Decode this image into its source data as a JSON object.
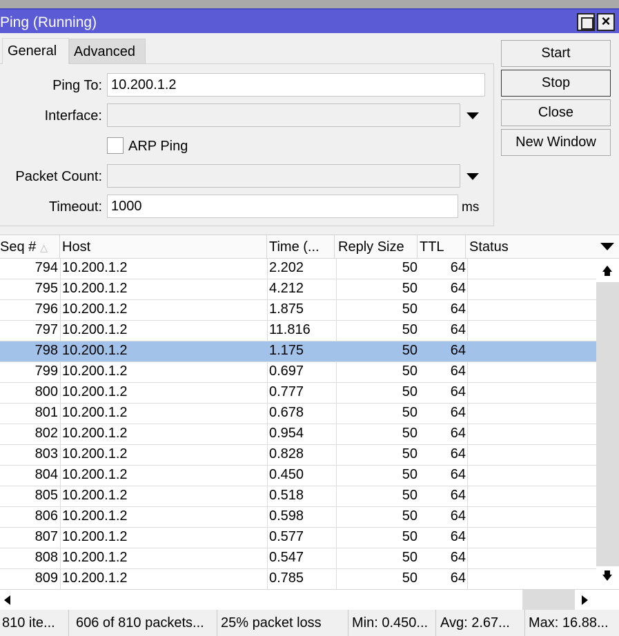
{
  "window": {
    "title": "Ping (Running)"
  },
  "tabs": [
    {
      "label": "General"
    },
    {
      "label": "Advanced"
    }
  ],
  "form": {
    "ping_to": {
      "label": "Ping To:",
      "value": "10.200.1.2"
    },
    "interface": {
      "label": "Interface:",
      "value": ""
    },
    "arp_ping": {
      "label": "ARP Ping",
      "checked": false
    },
    "packet_count": {
      "label": "Packet Count:",
      "value": ""
    },
    "timeout": {
      "label": "Timeout:",
      "value": "1000",
      "unit": "ms"
    }
  },
  "buttons": {
    "start": "Start",
    "stop": "Stop",
    "close": "Close",
    "new_window": "New Window"
  },
  "table": {
    "columns": [
      "Seq #",
      "Host",
      "Time (...",
      "Reply Size",
      "TTL",
      "Status"
    ],
    "selected_seq": "798",
    "rows": [
      {
        "seq": "794",
        "host": "10.200.1.2",
        "time": "2.202",
        "reply_size": "50",
        "ttl": "64",
        "status": ""
      },
      {
        "seq": "795",
        "host": "10.200.1.2",
        "time": "4.212",
        "reply_size": "50",
        "ttl": "64",
        "status": ""
      },
      {
        "seq": "796",
        "host": "10.200.1.2",
        "time": "1.875",
        "reply_size": "50",
        "ttl": "64",
        "status": ""
      },
      {
        "seq": "797",
        "host": "10.200.1.2",
        "time": "11.816",
        "reply_size": "50",
        "ttl": "64",
        "status": ""
      },
      {
        "seq": "798",
        "host": "10.200.1.2",
        "time": "1.175",
        "reply_size": "50",
        "ttl": "64",
        "status": ""
      },
      {
        "seq": "799",
        "host": "10.200.1.2",
        "time": "0.697",
        "reply_size": "50",
        "ttl": "64",
        "status": ""
      },
      {
        "seq": "800",
        "host": "10.200.1.2",
        "time": "0.777",
        "reply_size": "50",
        "ttl": "64",
        "status": ""
      },
      {
        "seq": "801",
        "host": "10.200.1.2",
        "time": "0.678",
        "reply_size": "50",
        "ttl": "64",
        "status": ""
      },
      {
        "seq": "802",
        "host": "10.200.1.2",
        "time": "0.954",
        "reply_size": "50",
        "ttl": "64",
        "status": ""
      },
      {
        "seq": "803",
        "host": "10.200.1.2",
        "time": "0.828",
        "reply_size": "50",
        "ttl": "64",
        "status": ""
      },
      {
        "seq": "804",
        "host": "10.200.1.2",
        "time": "0.450",
        "reply_size": "50",
        "ttl": "64",
        "status": ""
      },
      {
        "seq": "805",
        "host": "10.200.1.2",
        "time": "0.518",
        "reply_size": "50",
        "ttl": "64",
        "status": ""
      },
      {
        "seq": "806",
        "host": "10.200.1.2",
        "time": "0.598",
        "reply_size": "50",
        "ttl": "64",
        "status": ""
      },
      {
        "seq": "807",
        "host": "10.200.1.2",
        "time": "0.577",
        "reply_size": "50",
        "ttl": "64",
        "status": ""
      },
      {
        "seq": "808",
        "host": "10.200.1.2",
        "time": "0.547",
        "reply_size": "50",
        "ttl": "64",
        "status": ""
      },
      {
        "seq": "809",
        "host": "10.200.1.2",
        "time": "0.785",
        "reply_size": "50",
        "ttl": "64",
        "status": ""
      }
    ]
  },
  "status_bar": {
    "items": "810 ite...",
    "packets": "606 of 810 packets...",
    "loss": "25% packet loss",
    "min": "Min: 0.450...",
    "avg": "Avg: 2.67...",
    "max": "Max: 16.88..."
  },
  "icons": {
    "maximize": "maximize-icon",
    "close": "close-icon",
    "dropdown": "chevron-down-icon",
    "sort": "sort-ascending-icon",
    "scroll_up": "scroll-up-icon",
    "scroll_down": "scroll-down-icon",
    "scroll_left": "scroll-left-icon",
    "scroll_right": "scroll-right-icon"
  },
  "colors": {
    "titlebar": "#5b5bd6",
    "selected_row": "#a3c2ea",
    "window_bg": "#f0f0f0"
  }
}
